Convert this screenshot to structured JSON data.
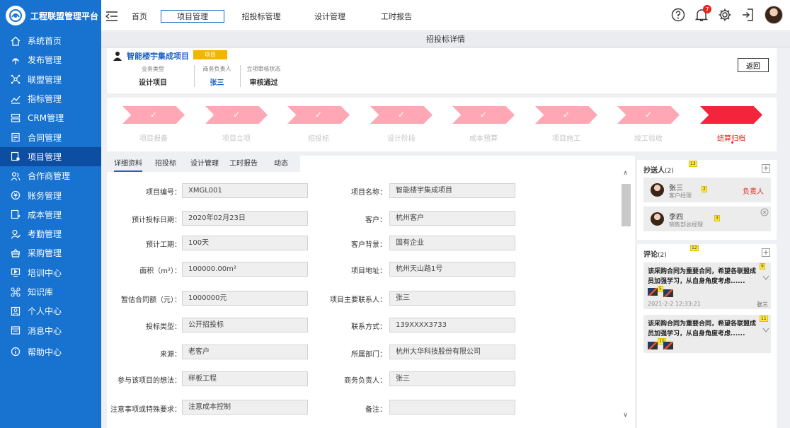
{
  "brand": {
    "title": "工程联盟管理平台"
  },
  "sidebar": {
    "items": [
      {
        "label": "系统首页",
        "icon": "home-icon"
      },
      {
        "label": "发布管理",
        "icon": "publish-icon"
      },
      {
        "label": "联盟管理",
        "icon": "network-icon"
      },
      {
        "label": "指标管理",
        "icon": "chart-icon"
      },
      {
        "label": "CRM管理",
        "icon": "server-icon"
      },
      {
        "label": "合同管理",
        "icon": "contract-icon"
      },
      {
        "label": "项目管理",
        "icon": "project-icon",
        "active": true
      },
      {
        "label": "合作商管理",
        "icon": "partner-icon"
      },
      {
        "label": "账务管理",
        "icon": "finance-icon"
      },
      {
        "label": "成本管理",
        "icon": "cost-icon"
      },
      {
        "label": "考勤管理",
        "icon": "attendance-icon"
      },
      {
        "label": "采购管理",
        "icon": "purchase-icon"
      },
      {
        "label": "培训中心",
        "icon": "training-icon"
      },
      {
        "label": "知识库",
        "icon": "knowledge-icon"
      },
      {
        "label": "个人中心",
        "icon": "user-icon"
      },
      {
        "label": "消息中心",
        "icon": "message-icon"
      },
      {
        "label": "帮助中心",
        "icon": "help-icon"
      }
    ]
  },
  "topbar": {
    "tabs": [
      "首页",
      "项目管理",
      "招投标管理",
      "设计管理",
      "工时报告"
    ],
    "active_tab": "项目管理",
    "notification_count": "7"
  },
  "page": {
    "title": "招投标详情"
  },
  "header": {
    "project_name": "智能楼宇集成项目",
    "tag": "项目",
    "meta": [
      {
        "label": "业务类型",
        "value": "设计项目"
      },
      {
        "label": "商务负责人",
        "value": "张三"
      },
      {
        "label": "立项审核状态",
        "value": "审核通过"
      }
    ],
    "back_label": "返回"
  },
  "steps": {
    "check": "✓",
    "items": [
      "项目报备",
      "项目立项",
      "招投标",
      "设计阶段",
      "成本预算",
      "项目施工",
      "竣工验收",
      "结算归档"
    ],
    "current_index": 7
  },
  "detail": {
    "tabs": [
      "详细资料",
      "招投标",
      "设计管理",
      "工时报告",
      "动态"
    ],
    "fields": [
      {
        "label": "项目编号：",
        "value": "XMGL001"
      },
      {
        "label": "项目名称：",
        "value": "智能楼宇集成项目"
      },
      {
        "label": "预计投标日期：",
        "value": "2020年02月23日"
      },
      {
        "label": "客户：",
        "value": "杭州客户"
      },
      {
        "label": "预计工期：",
        "value": "100天"
      },
      {
        "label": "客户背景：",
        "value": "国有企业"
      },
      {
        "label": "面积（m²）：",
        "value": "100000.00m²"
      },
      {
        "label": "项目地址：",
        "value": "杭州天山路1号"
      },
      {
        "label": "暂估合同额（元）：",
        "value": "1000000元"
      },
      {
        "label": "项目主要联系人：",
        "value": "张三"
      },
      {
        "label": "投标类型：",
        "value": "公开招投标"
      },
      {
        "label": "联系方式：",
        "value": "139XXXX3733"
      },
      {
        "label": "来源：",
        "value": "老客户"
      },
      {
        "label": "所属部门：",
        "value": "杭州大华科技股份有限公司"
      },
      {
        "label": "参与该项目的想法：",
        "value": "样板工程"
      },
      {
        "label": "商务负责人：",
        "value": "张三"
      },
      {
        "label": "注意事项或特殊要求：",
        "value": "注意成本控制"
      },
      {
        "label": "备注：",
        "value": ""
      }
    ]
  },
  "cc": {
    "title": "抄送人",
    "count": "(2)",
    "badge": "13",
    "people": [
      {
        "name": "张三",
        "role": "客户经理",
        "badge": "2",
        "tag": "负责人"
      },
      {
        "name": "李四",
        "role": "销售部总经理",
        "badge": "3"
      }
    ]
  },
  "comments": {
    "title": "评论",
    "count": "(2)",
    "badge": "12",
    "items": [
      {
        "text": "该采购合同为重要合同，希望各联盟成员加强学习，从自身角度考虑......",
        "badge": "9",
        "thumb_badge": "5",
        "date": "2021-2-2 12:33:21",
        "user": "张三"
      },
      {
        "text": "该采购合同为重要合同，希望各联盟成员加强学习，从自身角度考虑......",
        "badge": "11",
        "thumb_badge": "10"
      }
    ]
  },
  "colors": {
    "primary": "#1772d0",
    "active_nav": "#0b4ea2",
    "step": "#ffa7b4",
    "step_current": "#f3243b",
    "tag": "#f5b400"
  }
}
